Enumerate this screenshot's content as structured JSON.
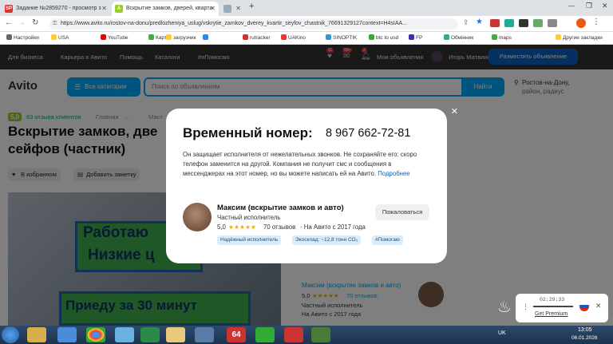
{
  "browser": {
    "tabs": [
      {
        "label": "Задание №2859270 - просмотр з",
        "favicon": "SP"
      },
      {
        "label": "Вскрытие замков, дверей, кварти",
        "favicon": "A"
      },
      {
        "label": "",
        "favicon": ""
      }
    ],
    "url": "https://www.avito.ru/rostov-na-donu/predlozheniya_uslug/vskrytie_zamkov_dverey_kvartir_seyfov_chastnik_766913291​27context=H4sIAA...",
    "bookmarks": [
      "Настройки",
      "USA",
      "YouTube",
      "Карты",
      "загрузчик",
      "ВКонтакте",
      "rutracker",
      "UAKino",
      "SINOPTIK",
      "btc to usd",
      "FP",
      "Обмінник",
      "maps",
      "Другие закладки"
    ]
  },
  "site_nav": {
    "items": [
      "Для бизнеса",
      "Карьера в Авито",
      "Помощь",
      "Каталоги",
      "#яПомогаю"
    ],
    "badges": [
      "11",
      "99+",
      "2"
    ],
    "my_ads": "Мои объявления",
    "user": "Игорь Матвиищ...",
    "post_button": "Разместить объявление"
  },
  "search": {
    "logo": "Avito",
    "categories_button": "Все категории",
    "placeholder": "Поиск по объявлениям",
    "find_button": "Найти",
    "location": "Ростов-на-Дону,",
    "radius": "район, радиус"
  },
  "listing": {
    "rating": "5,0",
    "reviews": "63 отзыва клиентов",
    "breadcrumbs": [
      "Главная",
      "·",
      "...",
      "·",
      "Маст"
    ],
    "title_line1": "Вскрытие замков, две",
    "title_line2": "сейфов (частник)",
    "favorite_button": "В избранном",
    "note_button": "Добавить заметку",
    "photo_text": [
      "Работаю",
      "Низкие ц",
      "Приеду за 30 минут"
    ],
    "seller_name": "Максим (вскрытие замков и авто)",
    "seller_rating": "5,0",
    "seller_reviews": "70 отзывов",
    "seller_type": "Частный исполнитель",
    "seller_since": "На Авито с 2017 года"
  },
  "modal": {
    "title": "Временный номер:",
    "phone": "8 967 662-72-81",
    "description": "Он защищает исполнителя от нежелательных звонков. Не сохраняйте его: скоро телефон заменится на другой. Компания не получит смс и сообщения в мессенджерах на этот номер, но вы можете написать ей на Авито.",
    "more_link": "Подробнее",
    "seller_name": "Максим (вскрытие замков и авто)",
    "seller_type": "Частный исполнитель",
    "rating": "5,0",
    "stars": "★★★★★",
    "reviews": "70 отзывов",
    "since": "· На Авито с 2017 года",
    "complain_button": "Пожаловаться",
    "tags": [
      "Надёжный исполнитель",
      "Экосклад: ~12,8 тонн CO₂",
      "#Помогаю"
    ],
    "close": "×"
  },
  "vpn_widget": {
    "timer": "02:29:33",
    "link": "Get Premium"
  },
  "taskbar": {
    "lang": "UK",
    "time": "13:05",
    "date": "06.01.2026"
  }
}
